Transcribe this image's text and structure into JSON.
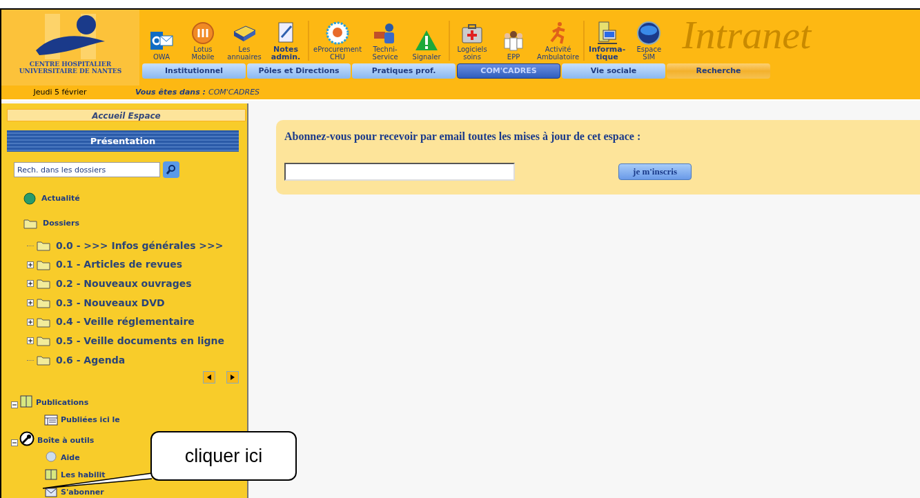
{
  "header": {
    "logo_text": "CENTRE HOSPITALIER\nUNIVERSITAIRE DE NANTES",
    "brand": "Intranet",
    "toolbar_groups": [
      [
        {
          "label": "OWA",
          "emphasis": false
        },
        {
          "label": "Lotus\nMobile",
          "emphasis": false
        },
        {
          "label": "Les\nannuaires",
          "emphasis": false
        },
        {
          "label": "Notes\nadmin.",
          "emphasis": true
        }
      ],
      [
        {
          "label": "eProcurement\nCHU",
          "emphasis": false
        },
        {
          "label": "Techni-\nService",
          "emphasis": false
        },
        {
          "label": "Signaler",
          "emphasis": false
        }
      ],
      [
        {
          "label": "Logiciels\nsoins",
          "emphasis": false
        },
        {
          "label": "EPP",
          "emphasis": false
        },
        {
          "label": "Activité\nAmbulatoire",
          "emphasis": false
        }
      ],
      [
        {
          "label": "Informa-\ntique",
          "emphasis": true
        },
        {
          "label": "Espace\nSIM",
          "emphasis": false
        }
      ]
    ],
    "tabs": [
      {
        "label": "Institutionnel",
        "kind": "tab",
        "selected": false
      },
      {
        "label": "Pôles et Directions",
        "kind": "tab",
        "selected": false
      },
      {
        "label": "Pratiques prof.",
        "kind": "tab",
        "selected": false
      },
      {
        "label": "COM'CADRES",
        "kind": "tab",
        "selected": true
      },
      {
        "label": "Vie sociale",
        "kind": "tab",
        "selected": false
      },
      {
        "label": "Recherche",
        "kind": "search",
        "selected": false
      }
    ]
  },
  "info_bar": {
    "date": "Jeudi 5 février",
    "location_label": "Vous êtes dans :",
    "location": "COM'CADRES"
  },
  "sidebar": {
    "home": "Accueil Espace",
    "section_title": "Présentation",
    "search": {
      "value": "Rech. dans les dossiers"
    },
    "tree": [
      {
        "label": "Actualité"
      },
      {
        "label": "Dossiers",
        "children": [
          {
            "label": "0.0 - >>> Infos générales >>>",
            "kind": "leaf"
          },
          {
            "label": "0.1 - Articles de revues",
            "kind": "expandable"
          },
          {
            "label": "0.2 - Nouveaux ouvrages",
            "kind": "expandable"
          },
          {
            "label": "0.3 - Nouveaux DVD",
            "kind": "expandable"
          },
          {
            "label": "0.4 - Veille réglementaire",
            "kind": "expandable"
          },
          {
            "label": "0.5 - Veille documents en ligne",
            "kind": "expandable"
          },
          {
            "label": "0.6 - Agenda",
            "kind": "leaf"
          }
        ]
      }
    ],
    "tools": [
      {
        "label": "Publications",
        "expanded": true,
        "children": [
          {
            "label": "Publiées ici le"
          }
        ]
      },
      {
        "label": "Boîte à outils",
        "expanded": true,
        "children": [
          {
            "label": "Aide"
          },
          {
            "label": "Les habilit"
          },
          {
            "label": "S'abonner"
          }
        ]
      }
    ]
  },
  "subscribe": {
    "title": "Abonnez-vous pour recevoir par email toutes les mises à jour de cet espace :",
    "button": "je m'inscris"
  },
  "callout": {
    "text": "cliquer ici"
  }
}
